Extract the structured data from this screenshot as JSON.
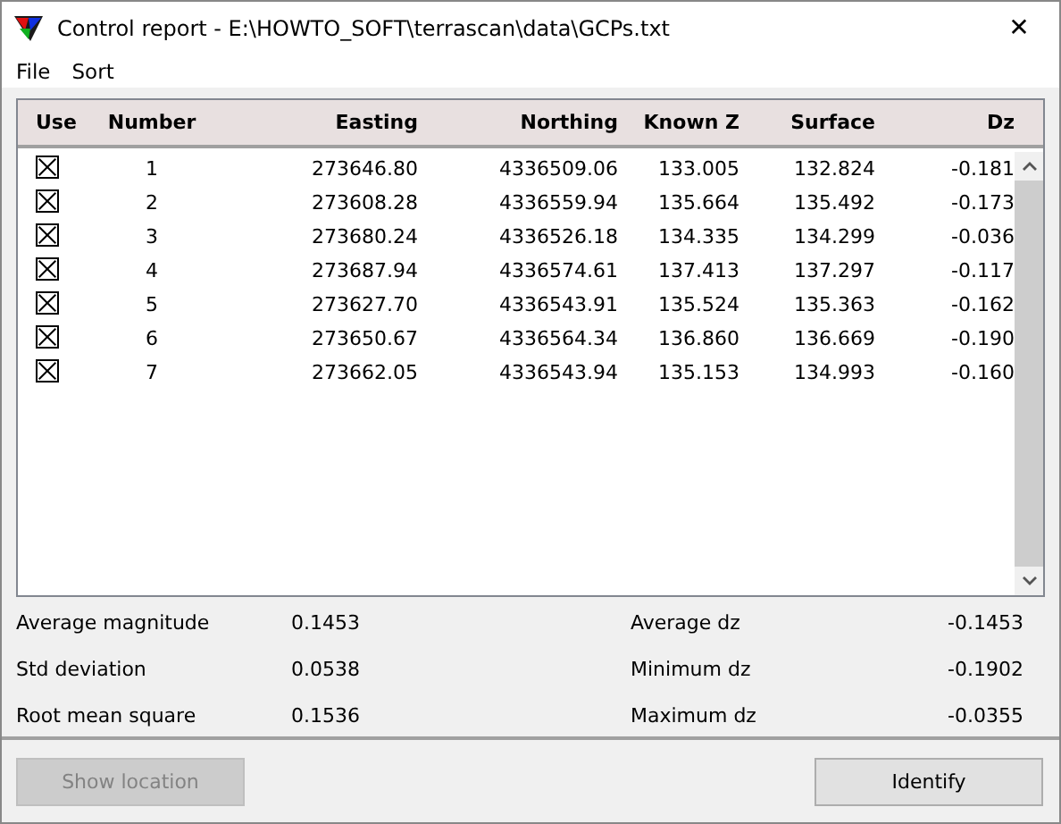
{
  "window": {
    "title": "Control report - E:\\HOWTO_SOFT\\terrascan\\data\\GCPs.txt",
    "close": "✕"
  },
  "menu": [
    "File",
    "Sort"
  ],
  "table": {
    "columns": [
      "Use",
      "Number",
      "Easting",
      "Northing",
      "Known Z",
      "Surface",
      "Dz"
    ],
    "rows": [
      {
        "use": true,
        "number": "1",
        "easting": "273646.80",
        "northing": "4336509.06",
        "known_z": "133.005",
        "surface": "132.824",
        "dz": "-0.181"
      },
      {
        "use": true,
        "number": "2",
        "easting": "273608.28",
        "northing": "4336559.94",
        "known_z": "135.664",
        "surface": "135.492",
        "dz": "-0.173"
      },
      {
        "use": true,
        "number": "3",
        "easting": "273680.24",
        "northing": "4336526.18",
        "known_z": "134.335",
        "surface": "134.299",
        "dz": "-0.036"
      },
      {
        "use": true,
        "number": "4",
        "easting": "273687.94",
        "northing": "4336574.61",
        "known_z": "137.413",
        "surface": "137.297",
        "dz": "-0.117"
      },
      {
        "use": true,
        "number": "5",
        "easting": "273627.70",
        "northing": "4336543.91",
        "known_z": "135.524",
        "surface": "135.363",
        "dz": "-0.162"
      },
      {
        "use": true,
        "number": "6",
        "easting": "273650.67",
        "northing": "4336564.34",
        "known_z": "136.860",
        "surface": "136.669",
        "dz": "-0.190"
      },
      {
        "use": true,
        "number": "7",
        "easting": "273662.05",
        "northing": "4336543.94",
        "known_z": "135.153",
        "surface": "134.993",
        "dz": "-0.160"
      }
    ]
  },
  "stats": [
    {
      "label": "Average magnitude",
      "value": "0.1453",
      "label_2": "Average dz",
      "value_2": "-0.1453"
    },
    {
      "label": "Std deviation",
      "value": "0.0538",
      "label_2": "Minimum dz",
      "value_2": "-0.1902"
    },
    {
      "label": "Root mean square",
      "value": "0.1536",
      "label_2": "Maximum dz",
      "value_2": "-0.0355"
    }
  ],
  "buttons": [
    {
      "label": "Show location",
      "disabled": true
    },
    {
      "label": "Identify",
      "disabled": false
    }
  ]
}
